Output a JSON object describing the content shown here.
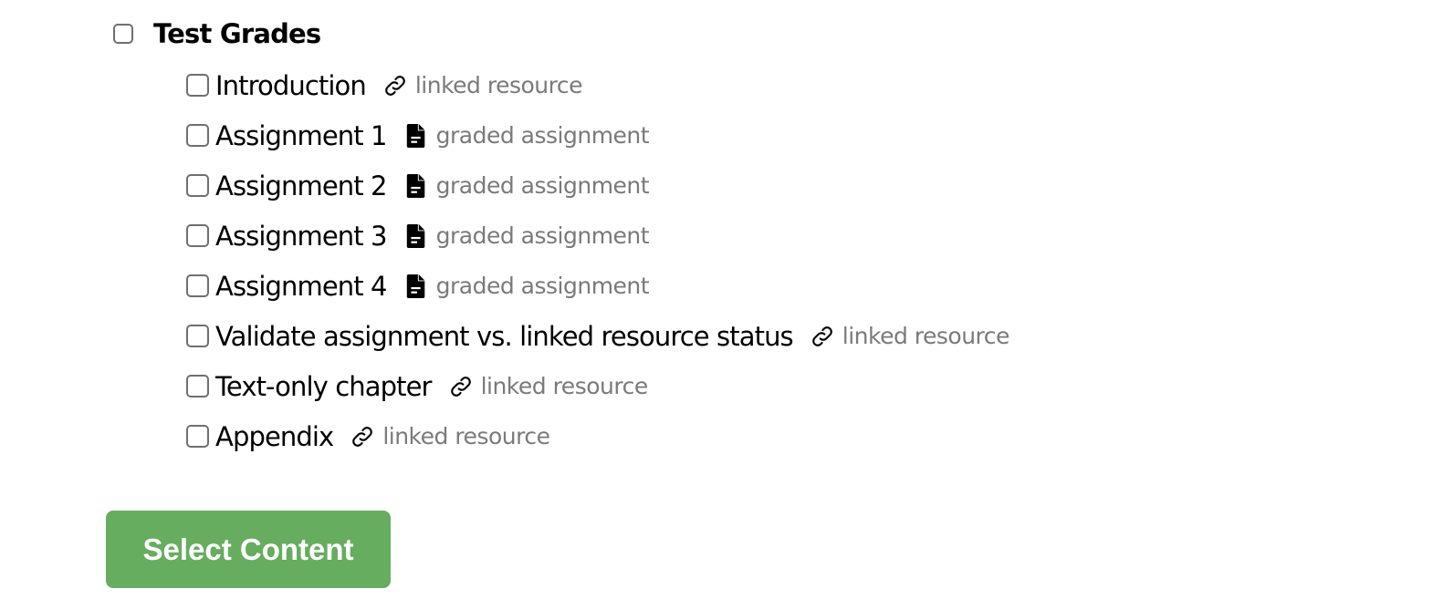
{
  "group": {
    "title": "Test Grades",
    "checked": false
  },
  "items": [
    {
      "label": "Introduction",
      "icon": "link-icon",
      "type_label": "linked resource",
      "checked": false
    },
    {
      "label": "Assignment 1",
      "icon": "file-icon",
      "type_label": "graded assignment",
      "checked": false
    },
    {
      "label": "Assignment 2",
      "icon": "file-icon",
      "type_label": "graded assignment",
      "checked": false
    },
    {
      "label": "Assignment 3",
      "icon": "file-icon",
      "type_label": "graded assignment",
      "checked": false
    },
    {
      "label": "Assignment 4",
      "icon": "file-icon",
      "type_label": "graded assignment",
      "checked": false
    },
    {
      "label": "Validate assignment vs. linked resource status",
      "icon": "link-icon",
      "type_label": "linked resource",
      "checked": false
    },
    {
      "label": "Text-only chapter",
      "icon": "link-icon",
      "type_label": "linked resource",
      "checked": false
    },
    {
      "label": "Appendix",
      "icon": "link-icon",
      "type_label": "linked resource",
      "checked": false
    }
  ],
  "actions": {
    "select_label": "Select Content"
  },
  "colors": {
    "button": "#66ad5f",
    "secondary_text": "#7a7a7a"
  }
}
